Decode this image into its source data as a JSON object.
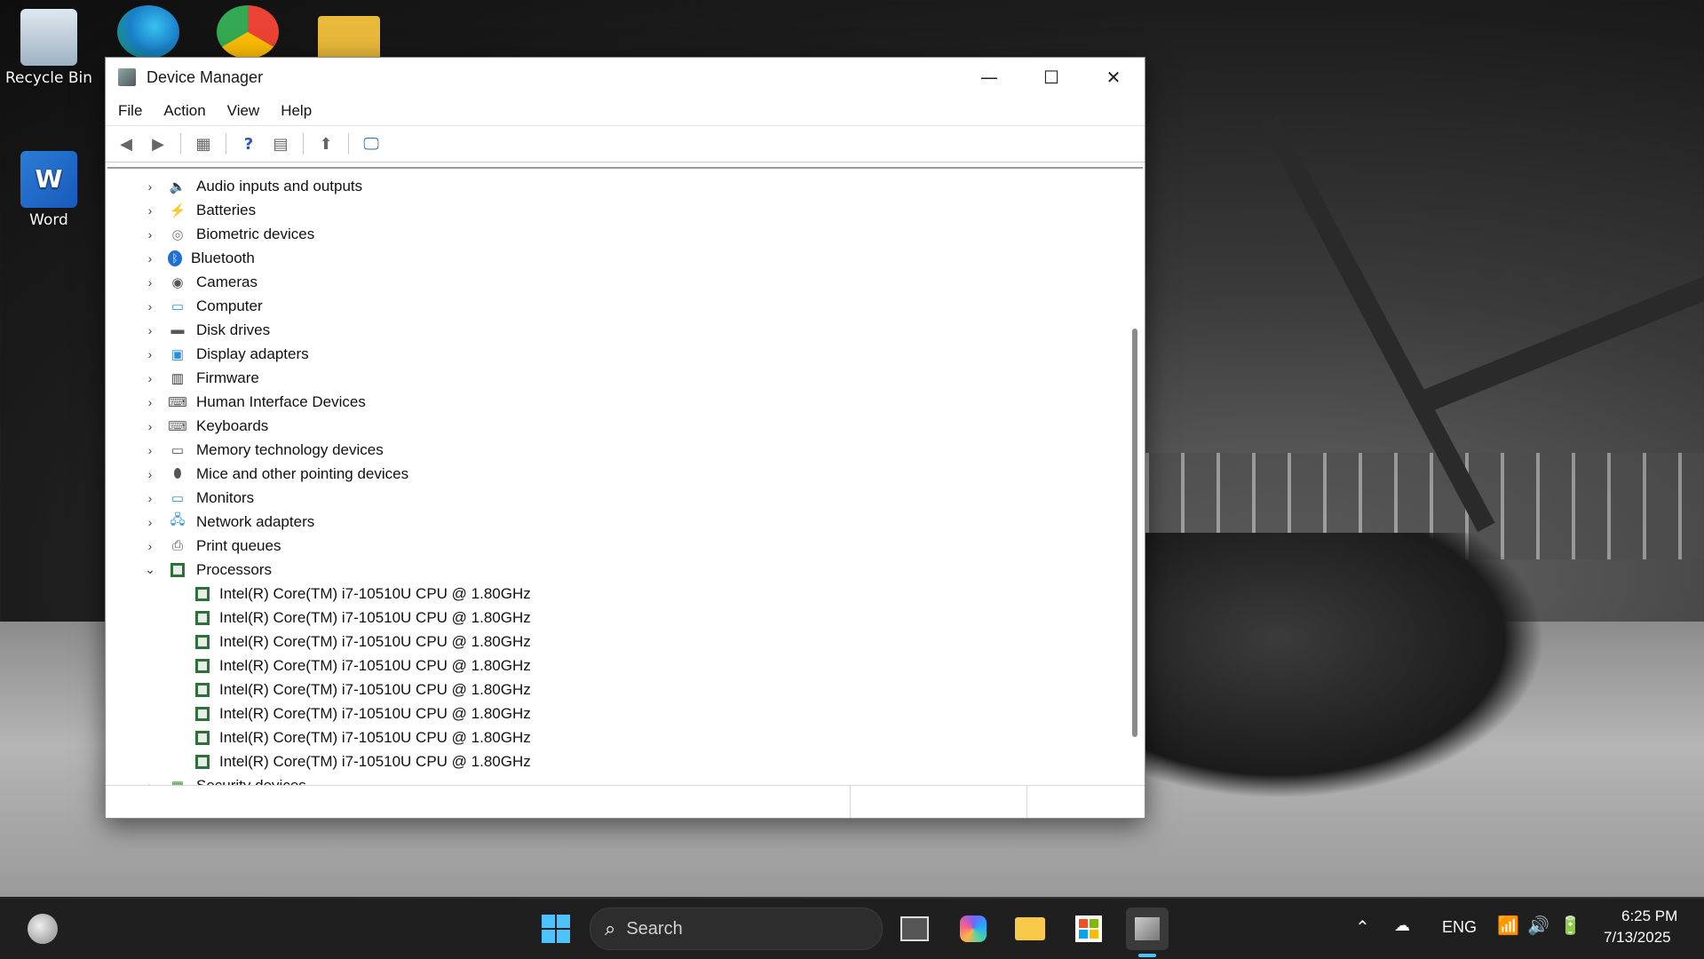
{
  "desktop": {
    "icons": [
      {
        "label": "Recycle Bin"
      },
      {
        "label": "Word"
      }
    ]
  },
  "window": {
    "title": "Device Manager",
    "controls": {
      "minimize": "—",
      "maximize": "☐",
      "close": "✕"
    },
    "menu": [
      "File",
      "Action",
      "View",
      "Help"
    ],
    "tree": {
      "categories": [
        "Audio inputs and outputs",
        "Batteries",
        "Biometric devices",
        "Bluetooth",
        "Cameras",
        "Computer",
        "Disk drives",
        "Display adapters",
        "Firmware",
        "Human Interface Devices",
        "Keyboards",
        "Memory technology devices",
        "Mice and other pointing devices",
        "Monitors",
        "Network adapters",
        "Print queues",
        "Processors"
      ],
      "processors": [
        "Intel(R) Core(TM) i7-10510U CPU @ 1.80GHz",
        "Intel(R) Core(TM) i7-10510U CPU @ 1.80GHz",
        "Intel(R) Core(TM) i7-10510U CPU @ 1.80GHz",
        "Intel(R) Core(TM) i7-10510U CPU @ 1.80GHz",
        "Intel(R) Core(TM) i7-10510U CPU @ 1.80GHz",
        "Intel(R) Core(TM) i7-10510U CPU @ 1.80GHz",
        "Intel(R) Core(TM) i7-10510U CPU @ 1.80GHz",
        "Intel(R) Core(TM) i7-10510U CPU @ 1.80GHz"
      ],
      "after": "Security devices"
    }
  },
  "taskbar": {
    "search_label": "Search",
    "language": "ENG",
    "time": "6:25 PM",
    "date": "7/13/2025"
  },
  "colors": {
    "accent": "#0078d4",
    "taskbar": "#1f1f1f",
    "cpu_green": "#2f6f3a"
  }
}
